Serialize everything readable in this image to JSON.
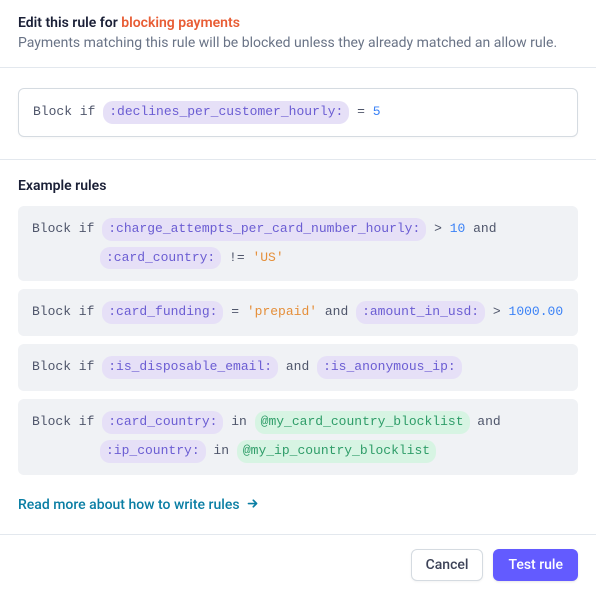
{
  "header": {
    "title_prefix": "Edit this rule for ",
    "title_accent": "blocking payments",
    "subtitle": "Payments matching this rule will be blocked unless they already matched an allow rule."
  },
  "editor": {
    "kw": "Block if",
    "attr": ":declines_per_customer_hourly:",
    "op": "=",
    "value": "5"
  },
  "examples": {
    "title": "Example rules",
    "rules": [
      {
        "parts_line1": [
          {
            "type": "kw",
            "text": "Block if "
          },
          {
            "type": "attr",
            "text": ":charge_attempts_per_card_number_hourly:"
          },
          {
            "type": "op",
            "text": " > "
          },
          {
            "type": "num",
            "text": "10"
          },
          {
            "type": "kw",
            "text": " and"
          }
        ],
        "parts_line2": [
          {
            "type": "attr",
            "text": ":card_country:"
          },
          {
            "type": "op",
            "text": " != "
          },
          {
            "type": "str",
            "text": "'US'"
          }
        ]
      },
      {
        "parts_line1": [
          {
            "type": "kw",
            "text": "Block if "
          },
          {
            "type": "attr",
            "text": ":card_funding:"
          },
          {
            "type": "op",
            "text": " = "
          },
          {
            "type": "str",
            "text": "'prepaid'"
          },
          {
            "type": "kw",
            "text": " and "
          },
          {
            "type": "attr",
            "text": ":amount_in_usd:"
          },
          {
            "type": "op",
            "text": " > "
          },
          {
            "type": "num",
            "text": "1000.00"
          }
        ]
      },
      {
        "parts_line1": [
          {
            "type": "kw",
            "text": "Block if "
          },
          {
            "type": "attr",
            "text": ":is_disposable_email:"
          },
          {
            "type": "kw",
            "text": " and "
          },
          {
            "type": "attr",
            "text": ":is_anonymous_ip:"
          }
        ]
      },
      {
        "parts_line1": [
          {
            "type": "kw",
            "text": "Block if "
          },
          {
            "type": "attr",
            "text": ":card_country:"
          },
          {
            "type": "kw",
            "text": " in "
          },
          {
            "type": "list",
            "text": "@my_card_country_blocklist"
          },
          {
            "type": "kw",
            "text": " and"
          }
        ],
        "parts_line2": [
          {
            "type": "attr",
            "text": ":ip_country:"
          },
          {
            "type": "kw",
            "text": " in "
          },
          {
            "type": "list",
            "text": "@my_ip_country_blocklist"
          }
        ]
      }
    ],
    "readmore": "Read more about how to write rules"
  },
  "footer": {
    "cancel": "Cancel",
    "test": "Test rule"
  }
}
